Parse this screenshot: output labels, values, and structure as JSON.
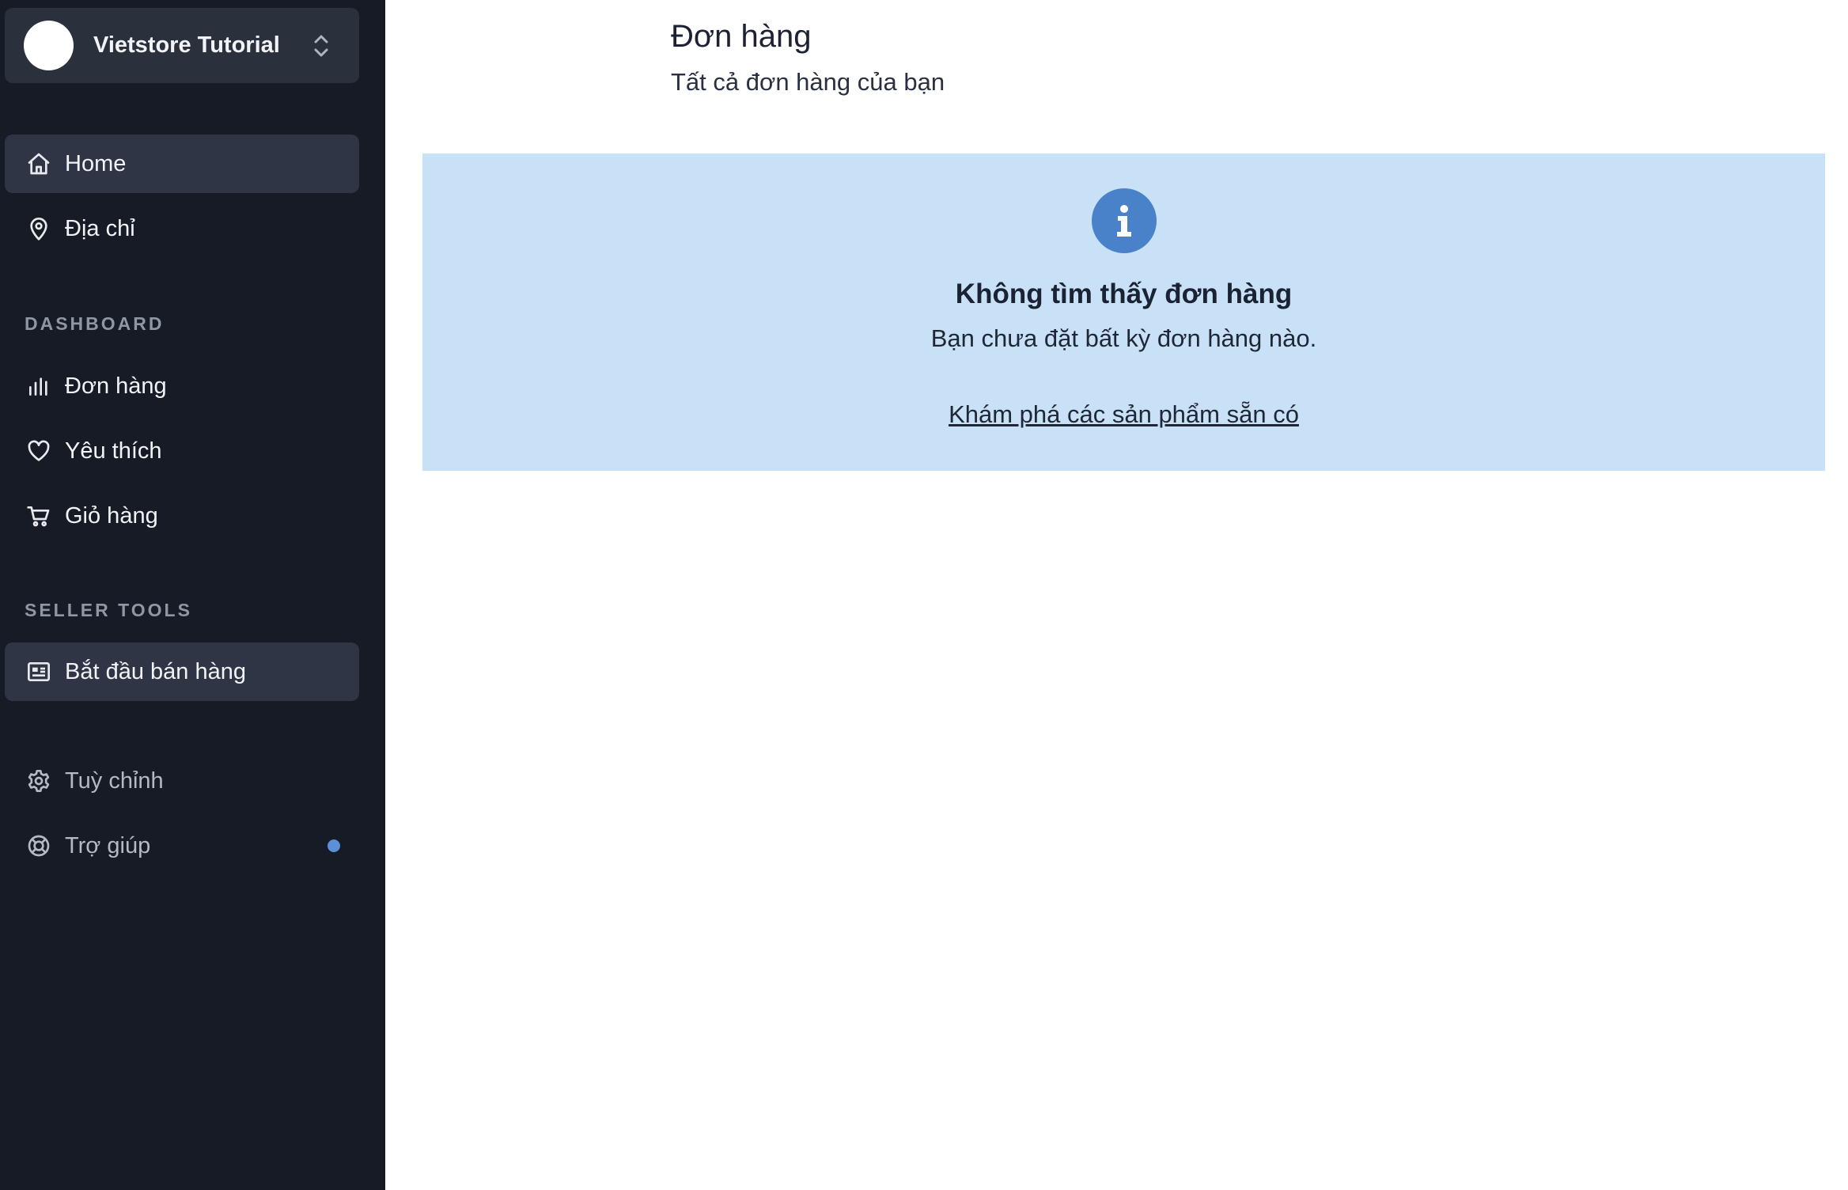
{
  "sidebar": {
    "store": {
      "name": "Vietstore Tutorial"
    },
    "items": [
      {
        "label": "Home",
        "icon": "home-icon",
        "active": true
      },
      {
        "label": "Địa chỉ",
        "icon": "map-pin-icon",
        "active": false
      }
    ],
    "dashboard": {
      "heading": "DASHBOARD",
      "items": [
        {
          "label": "Đơn hàng",
          "icon": "bar-chart-icon"
        },
        {
          "label": "Yêu thích",
          "icon": "heart-icon"
        },
        {
          "label": "Giỏ hàng",
          "icon": "cart-icon"
        }
      ]
    },
    "seller_tools": {
      "heading": "SELLER TOOLS",
      "items": [
        {
          "label": "Bắt đầu bán hàng",
          "icon": "newspaper-icon",
          "active": true
        }
      ]
    },
    "bottom": [
      {
        "label": "Tuỳ chỉnh",
        "icon": "gear-icon"
      },
      {
        "label": "Trợ giúp",
        "icon": "lifebuoy-icon",
        "has_notification": true
      }
    ]
  },
  "main": {
    "title": "Đơn hàng",
    "subtitle": "Tất cả đơn hàng của bạn",
    "empty_state": {
      "icon": "info-icon",
      "title": "Không tìm thấy đơn hàng",
      "message": "Bạn chưa đặt bất kỳ đơn hàng nào.",
      "link": "Khám phá các sản phẩm sẵn có"
    }
  },
  "colors": {
    "sidebar_bg": "#171b25",
    "active_item_bg": "#2f3544",
    "alert_bg": "#c8e1f6",
    "info_icon": "#4a82c9",
    "notification_dot": "#5b8fd8"
  }
}
